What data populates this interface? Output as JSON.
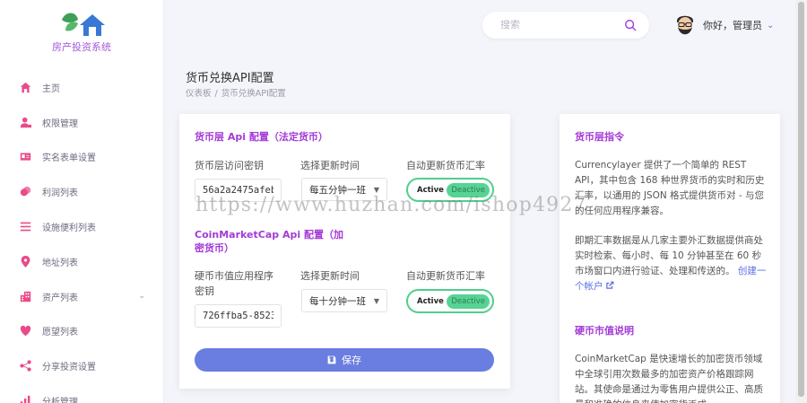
{
  "app": {
    "logo_text": "房产投资系统"
  },
  "sidebar": {
    "items": [
      {
        "label": "主页",
        "icon": "home-icon"
      },
      {
        "label": "权限管理",
        "icon": "user-lock-icon"
      },
      {
        "label": "实名表单设置",
        "icon": "id-card-icon"
      },
      {
        "label": "利润列表",
        "icon": "coins-icon"
      },
      {
        "label": "设施便利列表",
        "icon": "list-icon"
      },
      {
        "label": "地址列表",
        "icon": "map-pin-icon"
      },
      {
        "label": "资产列表",
        "icon": "building-icon",
        "has_children": true
      },
      {
        "label": "愿望列表",
        "icon": "heart-icon"
      },
      {
        "label": "分享投资设置",
        "icon": "share-icon"
      },
      {
        "label": "分析管理",
        "icon": "chart-icon"
      }
    ],
    "chevron": "⌄"
  },
  "header": {
    "search_placeholder": "搜索",
    "greeting": "你好，管理员",
    "chevron": "⌄"
  },
  "page": {
    "title": "货币兑换API配置",
    "breadcrumb": [
      "仪表板",
      "货币兑换API配置"
    ],
    "breadcrumb_sep": "/"
  },
  "currency_layer": {
    "title": "货币层 Api 配置（法定货币）",
    "key_label": "货币层访问密钥",
    "key_value": "56a2a2475afeb",
    "interval_label": "选择更新时间",
    "interval_value": "每五分钟一班",
    "auto_label": "自动更新货币汇率",
    "toggle_on": "Active",
    "toggle_off": "Deactive"
  },
  "coin_market": {
    "title_line1": "CoinMarketCap Api 配置（加",
    "title_line2": "密货币）",
    "key_label_line1": "硬币市值应用程序",
    "key_label_line2": "密钥",
    "key_value": "726ffba5-8523",
    "interval_label": "选择更新时间",
    "interval_value": "每十分钟一班",
    "auto_label": "自动更新货币汇率",
    "toggle_on": "Active",
    "toggle_off": "Deactive"
  },
  "save_label": "保存",
  "guide": {
    "title1": "货币层指令",
    "para1": "Currencylayer 提供了一个简单的 REST API，其中包含 168 种世界货币的实时和历史汇率，以通用的 JSON 格式提供货币对 - 与您的任何应用程序兼容。",
    "para2": "即期汇率数据是从几家主要外汇数据提供商处实时检索、每小时、每 10 分钟甚至在 60 秒市场窗口内进行验证、处理和传送的。",
    "link": "创建一个帐户",
    "title2": "硬币市值说明",
    "para3": "CoinMarketCap 是快速增长的加密货币领域中全球引用次数最多的加密资产价格跟踪网站。其使命是通过为零售用户提供公正、高质量和准确的信息来使加密货币成"
  },
  "watermark": "https://www.huzhan.com/ishop4927"
}
